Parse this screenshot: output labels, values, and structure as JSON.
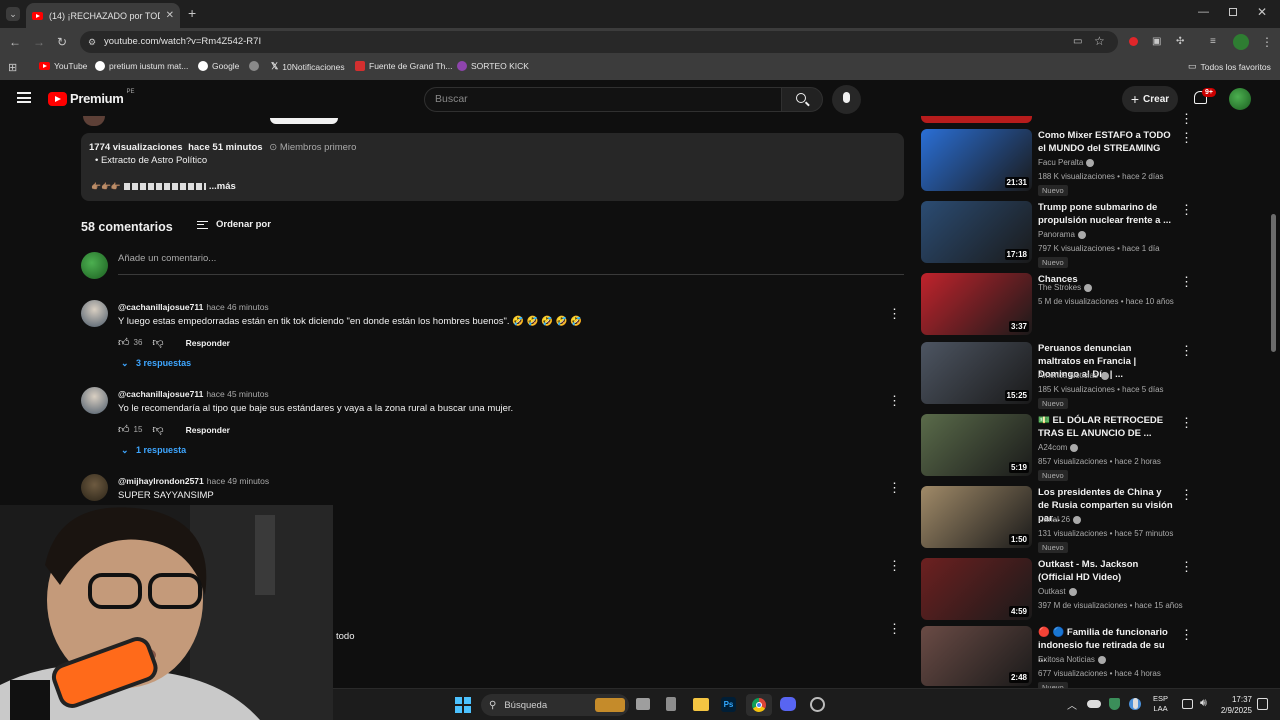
{
  "browser": {
    "tab_title": "(14) ¡RECHAZADO por TODAS",
    "url": "youtube.com/watch?v=Rm4Z542-R7I",
    "bookmarks": [
      "YouTube",
      "pretium iustum mat...",
      "Google",
      "10Notificaciones",
      "Fuente de Grand Th...",
      "SORTEO KICK"
    ],
    "all_bookmarks": "Todos los favoritos"
  },
  "yt_header": {
    "logo": "Premium",
    "region": "PE",
    "search_placeholder": "Buscar",
    "create_label": "Crear",
    "notif_count": "9+"
  },
  "description": {
    "views": "1774 visualizaciones",
    "time": "hace 51 minutos",
    "members": "Miembros primero",
    "bullet": "Extracto de Astro Político",
    "more": "...más"
  },
  "comments_header": {
    "count": "58 comentarios",
    "sort": "Ordenar por",
    "add_placeholder": "Añade un comentario..."
  },
  "comments": [
    {
      "user": "@cachanillajosue711",
      "time": "hace 46 minutos",
      "text": "Y luego estas empedorradas están en tik tok diciendo \"en donde están los hombres buenos\". 🤣 🤣 🤣 🤣 🤣",
      "likes": "36",
      "reply": "Responder",
      "replies": "3 respuestas"
    },
    {
      "user": "@cachanillajosue711",
      "time": "hace 45 minutos",
      "text": "Yo le recomendaría al tipo que baje sus estándares y vaya a la zona rural a buscar una mujer.",
      "likes": "15",
      "reply": "Responder",
      "replies": "1 respuesta"
    },
    {
      "user": "@mijhaylrondon2571",
      "time": "hace 49 minutos",
      "text": "SUPER SAYYANSIMP"
    }
  ],
  "partial_text": "todo",
  "related": [
    {
      "title": "Como Mixer ESTAFO a TODO el MUNDO del STREAMING",
      "channel": "Facu Peralta",
      "meta": "188 K visualizaciones • hace 2 días",
      "badge": "Nuevo",
      "duration": "21:31",
      "color": "#2a6fd6"
    },
    {
      "title": "Trump pone submarino de propulsión nuclear frente a ...",
      "channel": "Panorama",
      "meta": "797 K visualizaciones • hace 1 día",
      "badge": "Nuevo",
      "duration": "17:18",
      "color": "#2b4c73"
    },
    {
      "title": "Chances",
      "channel": "The Strokes",
      "meta": "5 M de visualizaciones • hace 10 años",
      "badge": "",
      "duration": "3:37",
      "color": "#c0232c"
    },
    {
      "title": "Peruanos denuncian maltratos en Francia | Domingo al Día | ...",
      "channel": "América Noticias",
      "meta": "185 K visualizaciones • hace 5 días",
      "badge": "Nuevo",
      "duration": "15:25",
      "color": "#4d5562"
    },
    {
      "title": "💵 EL DÓLAR RETROCEDE TRAS EL ANUNCIO DE ...",
      "channel": "A24com",
      "meta": "857 visualizaciones • hace 2 horas",
      "badge": "Nuevo",
      "duration": "5:19",
      "color": "#5a6b4a"
    },
    {
      "title": "Los presidentes de China y de Rusia comparten su visión par...",
      "channel": "Canal 26",
      "meta": "131 visualizaciones • hace 57 minutos",
      "badge": "Nuevo",
      "duration": "1:50",
      "color": "#a08a68"
    },
    {
      "title": "Outkast - Ms. Jackson (Official HD Video)",
      "channel": "Outkast",
      "meta": "397 M de visualizaciones • hace 15 años",
      "badge": "",
      "duration": "4:59",
      "color": "#6d2020"
    },
    {
      "title": "🔴 🔵 Familia de funcionario indonesio fue retirada de su ...",
      "channel": "Exitosa Noticias",
      "meta": "677 visualizaciones • hace 4 horas",
      "badge": "Nuevo",
      "duration": "2:48",
      "color": "#6a4b45"
    }
  ],
  "taskbar": {
    "search": "Búsqueda",
    "lang": "ESP",
    "lang2": "LAA",
    "time": "17:37",
    "date": "2/9/2025"
  },
  "colors": {
    "yt_red": "#ff0000",
    "link_blue": "#3ea6ff",
    "bg": "#0f0f0f"
  }
}
